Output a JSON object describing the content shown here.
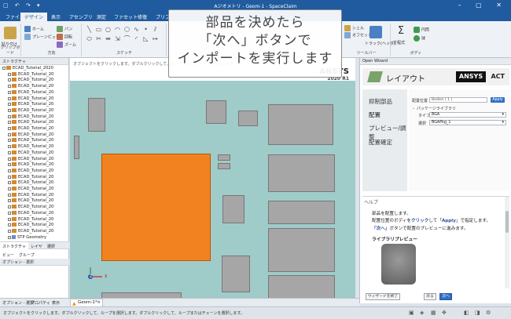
{
  "app": {
    "title": "Aジオメトリ - Geom-1 - SpaceClaim",
    "quick_access": "▢ ↶ ↷ ▾",
    "window_controls": "– ▢ ✕"
  },
  "ribbon": {
    "tabs": [
      "ファイル",
      "デザイン",
      "表示",
      "アセンブリ",
      "測定",
      "ファセット",
      "修復",
      "プリプ"
    ],
    "active_tab": "デザイン",
    "groups": {
      "clipboard": "クリップボード",
      "orient": "方向",
      "sketch": "スケッチ",
      "toolbar_right": "ツールバー",
      "body": "ボディ"
    },
    "buttons": {
      "paste": "貼り付け",
      "home": "ホーム",
      "pan": "パン",
      "rotate": "回転",
      "zoom": "ズーム",
      "plane_view": "プレーンビュー",
      "shell": "シェル",
      "offset": "オフセット",
      "track": "トラック(ヘッダ)",
      "equation": "方程式",
      "cylinder": "円筒",
      "sphere": "球"
    },
    "accents": {
      "blue": "#2e6fc7",
      "green": "#3f9a4b",
      "orange": "#e07a20"
    }
  },
  "left_panel": {
    "header": "ストラクチャ",
    "tree": [
      "ECAD_Tutorial_2020",
      "ECAD_Tutorial_20",
      "ECAD_Tutorial_20",
      "ECAD_Tutorial_20",
      "ECAD_Tutorial_20",
      "ECAD_Tutorial_20",
      "ECAD_Tutorial_20",
      "ECAD_Tutorial_20",
      "ECAD_Tutorial_20",
      "ECAD_Tutorial_20",
      "ECAD_Tutorial_20",
      "ECAD_Tutorial_20",
      "ECAD_Tutorial_20",
      "ECAD_Tutorial_20",
      "ECAD_Tutorial_20",
      "ECAD_Tutorial_20",
      "ECAD_Tutorial_20",
      "ECAD_Tutorial_20",
      "ECAD_Tutorial_20",
      "ECAD_Tutorial_20",
      "ECAD_Tutorial_20",
      "ECAD_Tutorial_20",
      "ECAD_Tutorial_20",
      "ECAD_Tutorial_20",
      "ECAD_Tutorial_20",
      "ECAD_Tutorial_20",
      "ECAD_Tutorial_20",
      "ECAD_Tutorial_20",
      "STP Geometry"
    ],
    "tabs": [
      "ストラクチャ",
      "レイヤ",
      "選択",
      "ビュー",
      "グループ"
    ],
    "options_header": "オプション - 選択",
    "bottom_tabs": [
      "オプション - 選択",
      "プロパティ",
      "表示"
    ]
  },
  "viewport": {
    "hint": "オブジェクトをクリックします。ダブルクリックして、ループまたはチェーンを選択します。",
    "brand": "ANSYS",
    "version": "2020 R1",
    "axis_z": "Z",
    "axis_x": "X",
    "doc_tab": "Geom-1*",
    "doc_tab_close": "×",
    "colors": {
      "board": "#9fcbc9",
      "bga": "#f28220",
      "pad": "#a6a6a6"
    }
  },
  "callout": {
    "lines": [
      "部品を決めたら",
      "「次へ」ボタンで",
      "インポートを実行します"
    ]
  },
  "wizard": {
    "panel_title": "Open Wizard",
    "header_title": "レイアウト",
    "logo_brand": "ANSYS",
    "logo_suffix": "ACT",
    "steps": [
      "抑制部品",
      "配置",
      "プレビュー/調整",
      "配置確定"
    ],
    "current_step": "配置",
    "form": {
      "position_label": "配置位置",
      "position_value": "Bodies ( 1 )",
      "apply_label": "Apply",
      "package_library_label": "パッケージライブラリ",
      "type_label": "タイプ",
      "type_value": "BGA",
      "select_label": "選択",
      "select_value": "BGAPkg_1"
    },
    "help": {
      "title": "ヘルプ",
      "line1": "部品を配置します。",
      "line2_pre": "配置位置のボディを",
      "line2_click": "クリック",
      "line2_mid": "して「",
      "line2_apply": "Apply",
      "line2_post": "」で指定します。",
      "line3_next": "「次へ」",
      "line3_post": "ボタンで配置のプレビューに進みます。",
      "preview_title": "ライブラリプレビュー"
    },
    "footer": {
      "close_wizard": "ウィザードを終了",
      "back": "戻る",
      "next": "次へ"
    }
  },
  "status": {
    "text": "オブジェクトをクリックします。ダブルクリックして、ループを選択します。ダブルクリックして、ループまたはチェーンを選択します。"
  }
}
